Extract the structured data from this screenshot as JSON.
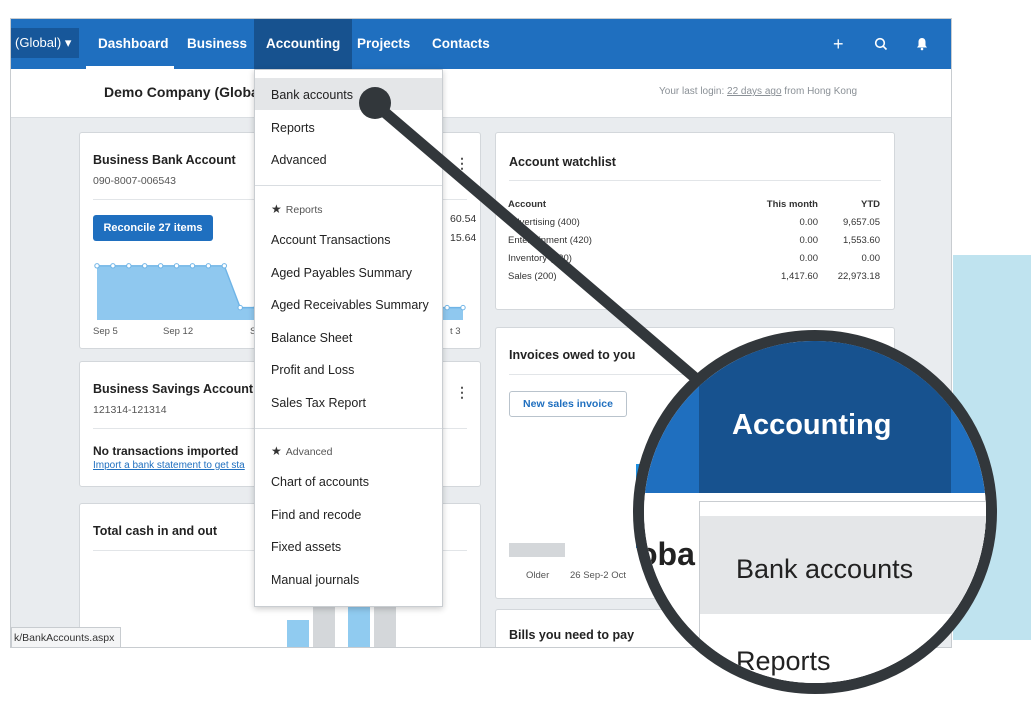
{
  "nav": {
    "org_label": "(Global) ▾",
    "items": [
      "Dashboard",
      "Business",
      "Accounting",
      "Projects",
      "Contacts"
    ],
    "add_icon": "+",
    "search_icon": "⌕",
    "bell_icon": "🔔"
  },
  "subheader": {
    "company": "Demo Company (Globa",
    "login_prefix": "Your last login: ",
    "login_link": "22 days ago",
    "login_suffix": " from Hong Kong"
  },
  "bank_card": {
    "title": "Business Bank Account",
    "account_no": "090-8007-006543",
    "reconcile_label": "Reconcile 27 items",
    "value1": "60.54",
    "value2": "15.64",
    "x_labels": [
      "Sep 5",
      "Sep 12",
      "S",
      "t 3"
    ],
    "chart_series": [
      0.9,
      0.9,
      0.9,
      0.9,
      0.9,
      0.9,
      0.9,
      0.9,
      0.9,
      0.15,
      0.15,
      0.15,
      0.15,
      0.15,
      0.15,
      0.15,
      0.15,
      0.15,
      0.15,
      0.15,
      0.15,
      0.15,
      0.15,
      0.15
    ]
  },
  "savings_card": {
    "title": "Business Savings Account",
    "account_no": "121314-121314",
    "no_tx": "No transactions imported",
    "import_link": "Import a bank statement to get sta"
  },
  "cash_card": {
    "title": "Total cash in and out"
  },
  "watchlist": {
    "title": "Account watchlist",
    "headers": [
      "Account",
      "This month",
      "YTD"
    ],
    "rows": [
      [
        "Advertising (400)",
        "0.00",
        "9,657.05"
      ],
      [
        "Entertainment (420)",
        "0.00",
        "1,553.60"
      ],
      [
        "Inventory (630)",
        "0.00",
        "0.00"
      ],
      [
        "Sales (200)",
        "1,417.60",
        "22,973.18"
      ]
    ]
  },
  "invoices": {
    "title": "Invoices owed to you",
    "new_invoice": "New sales invoice",
    "x_labels": [
      "Older",
      "26 Sep-2 Oct"
    ]
  },
  "bills": {
    "title": "Bills you need to pay"
  },
  "menu": {
    "items_top": [
      "Bank accounts",
      "Reports",
      "Advanced"
    ],
    "reports_header": "Reports",
    "reports_items": [
      "Account Transactions",
      "Aged Payables Summary",
      "Aged Receivables Summary",
      "Balance Sheet",
      "Profit and Loss",
      "Sales Tax Report"
    ],
    "advanced_header": "Advanced",
    "advanced_items": [
      "Chart of accounts",
      "Find and recode",
      "Fixed assets",
      "Manual journals"
    ]
  },
  "statusbar": "k/BankAccounts.aspx",
  "magnifier": {
    "nav_active": "Accounting",
    "nav_next": "P",
    "company_fragment": "oba",
    "item1": "Bank accounts",
    "item2": "Reports"
  },
  "colors": {
    "nav_blue": "#1f6fbf",
    "nav_active": "#17528f",
    "background": "#e9ecef",
    "teal_panel": "#bfe3ef",
    "pointer": "#32373b"
  }
}
